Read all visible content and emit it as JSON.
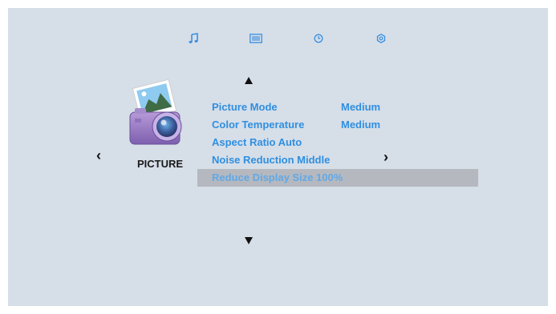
{
  "tabs": [
    {
      "icon": "music-note-icon"
    },
    {
      "icon": "list-icon"
    },
    {
      "icon": "clock-icon"
    },
    {
      "icon": "gear-icon"
    }
  ],
  "section": {
    "icon": "picture-camera-icon",
    "title": "PICTURE"
  },
  "menu": {
    "items": [
      {
        "label": "Picture Mode",
        "value": "Medium"
      },
      {
        "label": "Color Temperature",
        "value": "Medium"
      },
      {
        "label": "Aspect Ratio Auto",
        "value": ""
      },
      {
        "label": "Noise Reduction Middle",
        "value": ""
      },
      {
        "label": "Reduce Display Size 100%",
        "value": ""
      }
    ],
    "selected_index": 4
  },
  "colors": {
    "background": "#d6dee8",
    "text_blue": "#2f8fe0",
    "highlight": "#b5b9bf",
    "tab_icon": "#3a8fe0"
  }
}
